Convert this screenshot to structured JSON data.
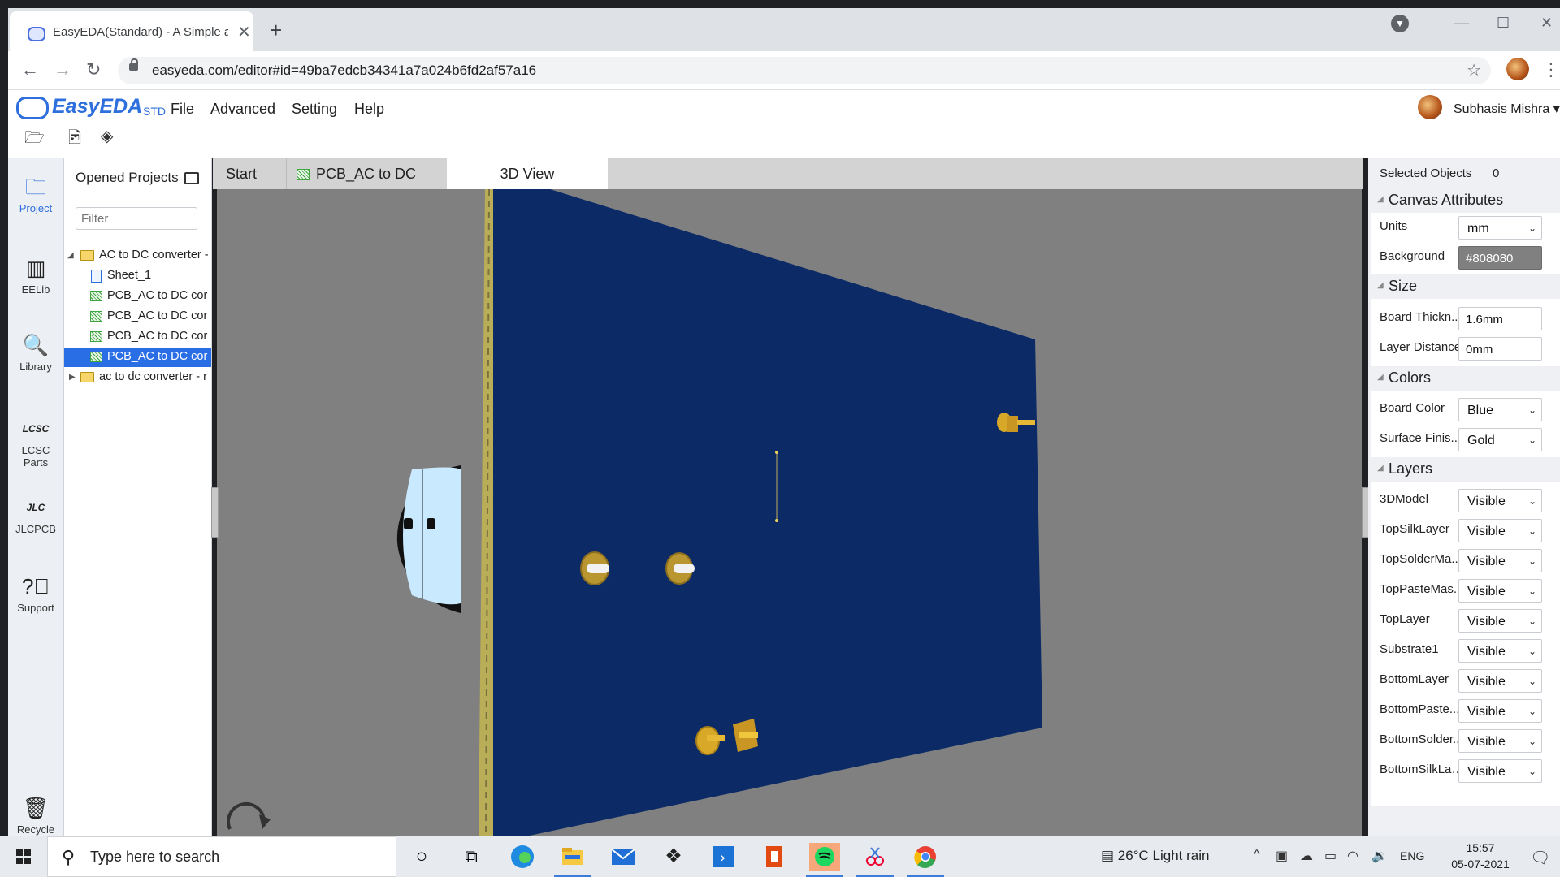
{
  "browser": {
    "tab_title": "EasyEDA(Standard) - A Simple and Powerful Electronic Circuit Design Tool",
    "url": "easyeda.com/editor#id=49ba7edcb34341a7a024b6fd2af57a16"
  },
  "app": {
    "brand": "EasyEDA",
    "edition": "STD",
    "menu": [
      "File",
      "Advanced",
      "Setting",
      "Help"
    ],
    "user_name": "Subhasis Mishra"
  },
  "rail": [
    {
      "label": "Project",
      "icon": "project-icon"
    },
    {
      "label": "EELib",
      "icon": "chip-icon"
    },
    {
      "label": "Library",
      "icon": "library-icon"
    },
    {
      "label": "LCSC Parts",
      "icon": "lcsc-icon"
    },
    {
      "label": "JLCPCB",
      "icon": "jlc-icon"
    },
    {
      "label": "Support",
      "icon": "help-icon"
    },
    {
      "label": "Recycle",
      "icon": "trash-icon"
    }
  ],
  "project_panel": {
    "title": "Opened Projects",
    "filter_placeholder": "Filter",
    "tree": [
      {
        "label": "AC to DC converter -",
        "type": "folder",
        "level": 0,
        "expanded": true
      },
      {
        "label": "Sheet_1",
        "type": "sheet",
        "level": 1
      },
      {
        "label": "PCB_AC to DC cor",
        "type": "pcb",
        "level": 1
      },
      {
        "label": "PCB_AC to DC cor",
        "type": "pcb",
        "level": 1
      },
      {
        "label": "PCB_AC to DC cor",
        "type": "pcb",
        "level": 1
      },
      {
        "label": "PCB_AC to DC cor",
        "type": "pcb",
        "level": 1,
        "selected": true
      },
      {
        "label": "ac to dc converter - r",
        "type": "folder",
        "level": 0,
        "expanded": false
      }
    ]
  },
  "editor_tabs": [
    "Start",
    "PCB_AC to DC c...",
    "3D View"
  ],
  "active_tab": "3D View",
  "properties": {
    "selected_label": "Selected Objects",
    "selected_count": "0",
    "sections": {
      "canvas": "Canvas Attributes",
      "size": "Size",
      "colors": "Colors",
      "layers": "Layers"
    },
    "units": {
      "label": "Units",
      "value": "mm"
    },
    "background": {
      "label": "Background",
      "value": "#808080"
    },
    "board_thickness": {
      "label": "Board Thickn...",
      "value": "1.6mm"
    },
    "layer_distance": {
      "label": "Layer Distance",
      "value": "0mm"
    },
    "board_color": {
      "label": "Board Color",
      "value": "Blue"
    },
    "surface_finish": {
      "label": "Surface Finis...",
      "value": "Gold"
    },
    "layers": [
      {
        "name": "3DModel",
        "value": "Visible"
      },
      {
        "name": "TopSilkLayer",
        "value": "Visible"
      },
      {
        "name": "TopSolderMa...",
        "value": "Visible"
      },
      {
        "name": "TopPasteMas...",
        "value": "Visible"
      },
      {
        "name": "TopLayer",
        "value": "Visible"
      },
      {
        "name": "Substrate1",
        "value": "Visible"
      },
      {
        "name": "BottomLayer",
        "value": "Visible"
      },
      {
        "name": "BottomPaste...",
        "value": "Visible"
      },
      {
        "name": "BottomSolder...",
        "value": "Visible"
      },
      {
        "name": "BottomSilkLayer",
        "value": "Visible"
      }
    ]
  },
  "colors": {
    "board": "#0b2a66",
    "board_edge": "#b9ad58",
    "canvas_bg": "#808080",
    "accent": "#2a6ee6"
  },
  "taskbar": {
    "search_placeholder": "Type here to search",
    "weather": "26°C  Light rain",
    "lang": "ENG",
    "time": "15:57",
    "date": "05-07-2021"
  }
}
